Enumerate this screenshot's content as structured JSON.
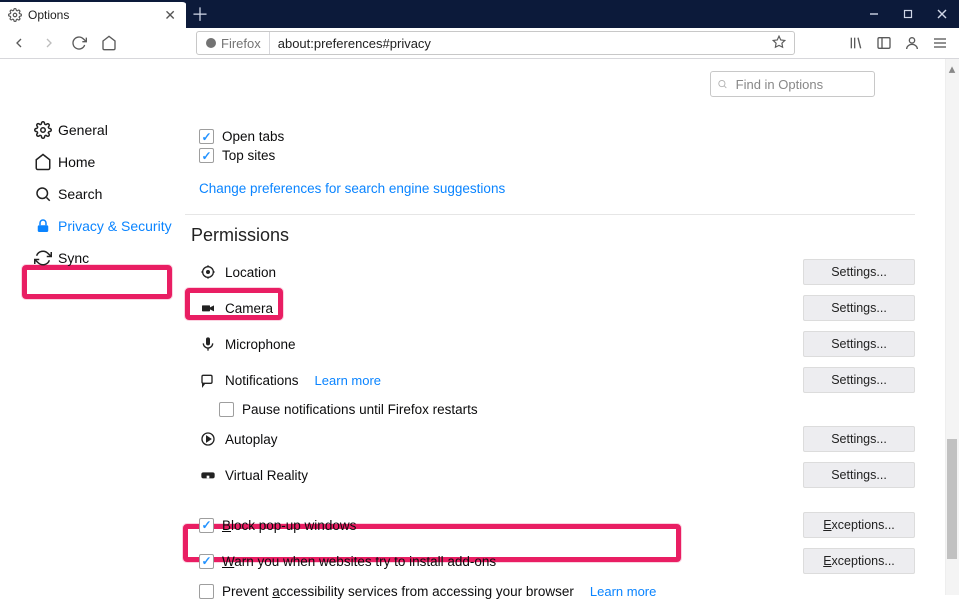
{
  "window": {
    "tab_title": "Options",
    "newtab_glyph": "＋"
  },
  "toolbar": {
    "origin_label": "Firefox",
    "url": "about:preferences#privacy"
  },
  "search": {
    "placeholder": "Find in Options"
  },
  "sidebar": {
    "items": [
      {
        "id": "general",
        "label": "General"
      },
      {
        "id": "home",
        "label": "Home"
      },
      {
        "id": "search",
        "label": "Search"
      },
      {
        "id": "privacy",
        "label": "Privacy & Security"
      },
      {
        "id": "sync",
        "label": "Sync"
      }
    ],
    "active": "privacy"
  },
  "top_checks": {
    "open_tabs": "Open tabs",
    "top_sites": "Top sites",
    "search_prefs_link": "Change preferences for search engine suggestions"
  },
  "permissions": {
    "title": "Permissions",
    "location": "Location",
    "camera": "Camera",
    "microphone": "Microphone",
    "notifications": "Notifications",
    "learn_more": "Learn more",
    "pause_notifications": "Pause notifications until Firefox restarts",
    "autoplay": "Autoplay",
    "vr": "Virtual Reality",
    "block_popup": "Block pop-up windows",
    "warn_addons": "Warn you when websites try to install add-ons",
    "prevent_a11y": "Prevent accessibility services from accessing your browser",
    "settings_btn": "Settings...",
    "exceptions_btn": "Exceptions..."
  }
}
